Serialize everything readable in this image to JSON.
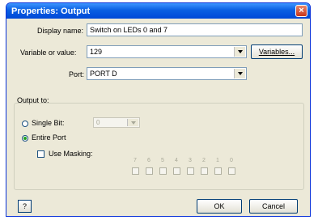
{
  "window": {
    "title": "Properties: Output",
    "close_label": "×"
  },
  "fields": {
    "display_name_label": "Display name:",
    "display_name_value": "Switch on LEDs 0 and 7",
    "variable_label": "Variable or value:",
    "variable_value": "129",
    "variables_button": "Variables...",
    "port_label": "Port:",
    "port_value": "PORT D"
  },
  "output_to": {
    "group_label": "Output to:",
    "single_bit_label": "Single Bit:",
    "single_bit_value": "0",
    "single_bit_selected": false,
    "entire_port_label": "Entire Port",
    "entire_port_selected": true,
    "use_masking_label": "Use Masking:",
    "use_masking_checked": false,
    "bit_labels": [
      "7",
      "6",
      "5",
      "4",
      "3",
      "2",
      "1",
      "0"
    ]
  },
  "footer": {
    "help_label": "?",
    "ok_label": "OK",
    "cancel_label": "Cancel"
  }
}
